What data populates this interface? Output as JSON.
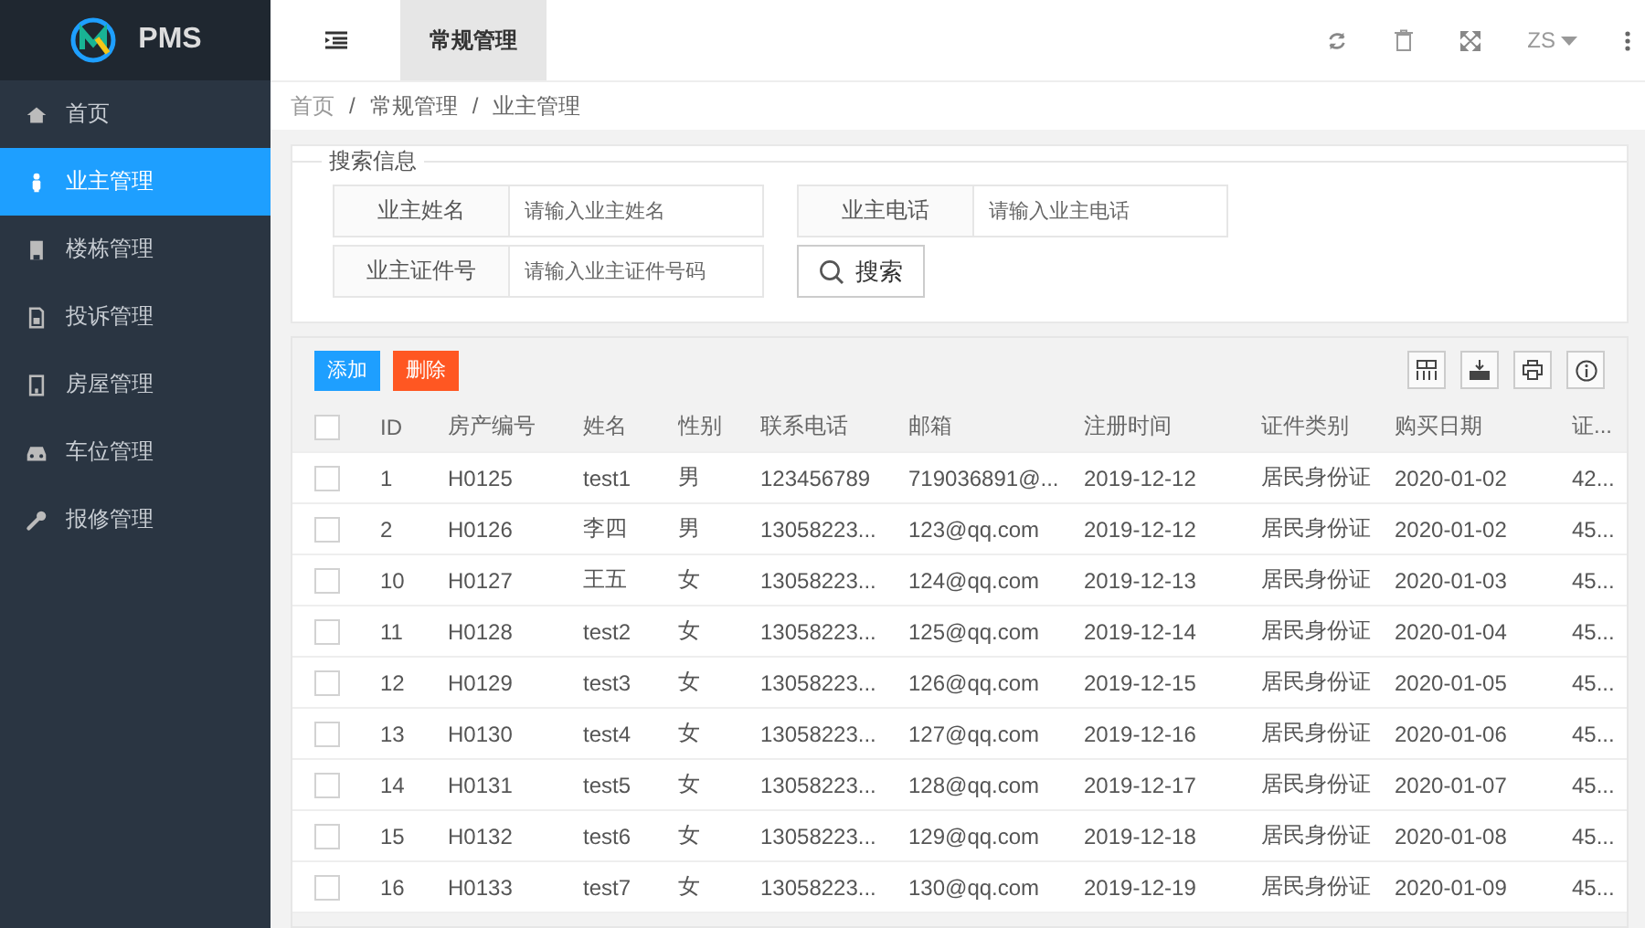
{
  "brand": {
    "name": "PMS"
  },
  "sidebar": {
    "items": [
      {
        "label": "首页",
        "selected": false
      },
      {
        "label": "业主管理",
        "selected": true
      },
      {
        "label": "楼栋管理",
        "selected": false
      },
      {
        "label": "投诉管理",
        "selected": false
      },
      {
        "label": "房屋管理",
        "selected": false
      },
      {
        "label": "车位管理",
        "selected": false
      },
      {
        "label": "报修管理",
        "selected": false
      }
    ]
  },
  "header": {
    "tabs": [
      {
        "label": "常规管理",
        "selected": true
      }
    ],
    "user": "ZS"
  },
  "breadcrumb": {
    "separator": "/",
    "items": [
      "首页",
      "常规管理",
      "业主管理"
    ]
  },
  "search": {
    "legend": "搜索信息",
    "fields": [
      {
        "label": "业主姓名",
        "placeholder": "请输入业主姓名"
      },
      {
        "label": "业主电话",
        "placeholder": "请输入业主电话"
      },
      {
        "label": "业主证件号",
        "placeholder": "请输入业主证件号码"
      }
    ],
    "button": "搜索"
  },
  "toolbar": {
    "add": "添加",
    "delete": "删除"
  },
  "table": {
    "all_checked": false,
    "columns": [
      "ID",
      "房产编号",
      "姓名",
      "性别",
      "联系电话",
      "邮箱",
      "注册时间",
      "证件类别",
      "购买日期",
      "证..."
    ],
    "rows": [
      {
        "checked": false,
        "cells": [
          "1",
          "H0125",
          "test1",
          "男",
          "123456789",
          "719036891@...",
          "2019-12-12",
          "居民身份证",
          "2020-01-02",
          "42..."
        ]
      },
      {
        "checked": false,
        "cells": [
          "2",
          "H0126",
          "李四",
          "男",
          "13058223...",
          "123@qq.com",
          "2019-12-12",
          "居民身份证",
          "2020-01-02",
          "45..."
        ]
      },
      {
        "checked": false,
        "cells": [
          "10",
          "H0127",
          "王五",
          "女",
          "13058223...",
          "124@qq.com",
          "2019-12-13",
          "居民身份证",
          "2020-01-03",
          "45..."
        ]
      },
      {
        "checked": false,
        "cells": [
          "11",
          "H0128",
          "test2",
          "女",
          "13058223...",
          "125@qq.com",
          "2019-12-14",
          "居民身份证",
          "2020-01-04",
          "45..."
        ]
      },
      {
        "checked": false,
        "cells": [
          "12",
          "H0129",
          "test3",
          "女",
          "13058223...",
          "126@qq.com",
          "2019-12-15",
          "居民身份证",
          "2020-01-05",
          "45..."
        ]
      },
      {
        "checked": false,
        "cells": [
          "13",
          "H0130",
          "test4",
          "女",
          "13058223...",
          "127@qq.com",
          "2019-12-16",
          "居民身份证",
          "2020-01-06",
          "45..."
        ]
      },
      {
        "checked": false,
        "cells": [
          "14",
          "H0131",
          "test5",
          "女",
          "13058223...",
          "128@qq.com",
          "2019-12-17",
          "居民身份证",
          "2020-01-07",
          "45..."
        ]
      },
      {
        "checked": false,
        "cells": [
          "15",
          "H0132",
          "test6",
          "女",
          "13058223...",
          "129@qq.com",
          "2019-12-18",
          "居民身份证",
          "2020-01-08",
          "45..."
        ]
      },
      {
        "checked": false,
        "cells": [
          "16",
          "H0133",
          "test7",
          "女",
          "13058223...",
          "130@qq.com",
          "2019-12-19",
          "居民身份证",
          "2020-01-09",
          "45..."
        ]
      }
    ]
  }
}
